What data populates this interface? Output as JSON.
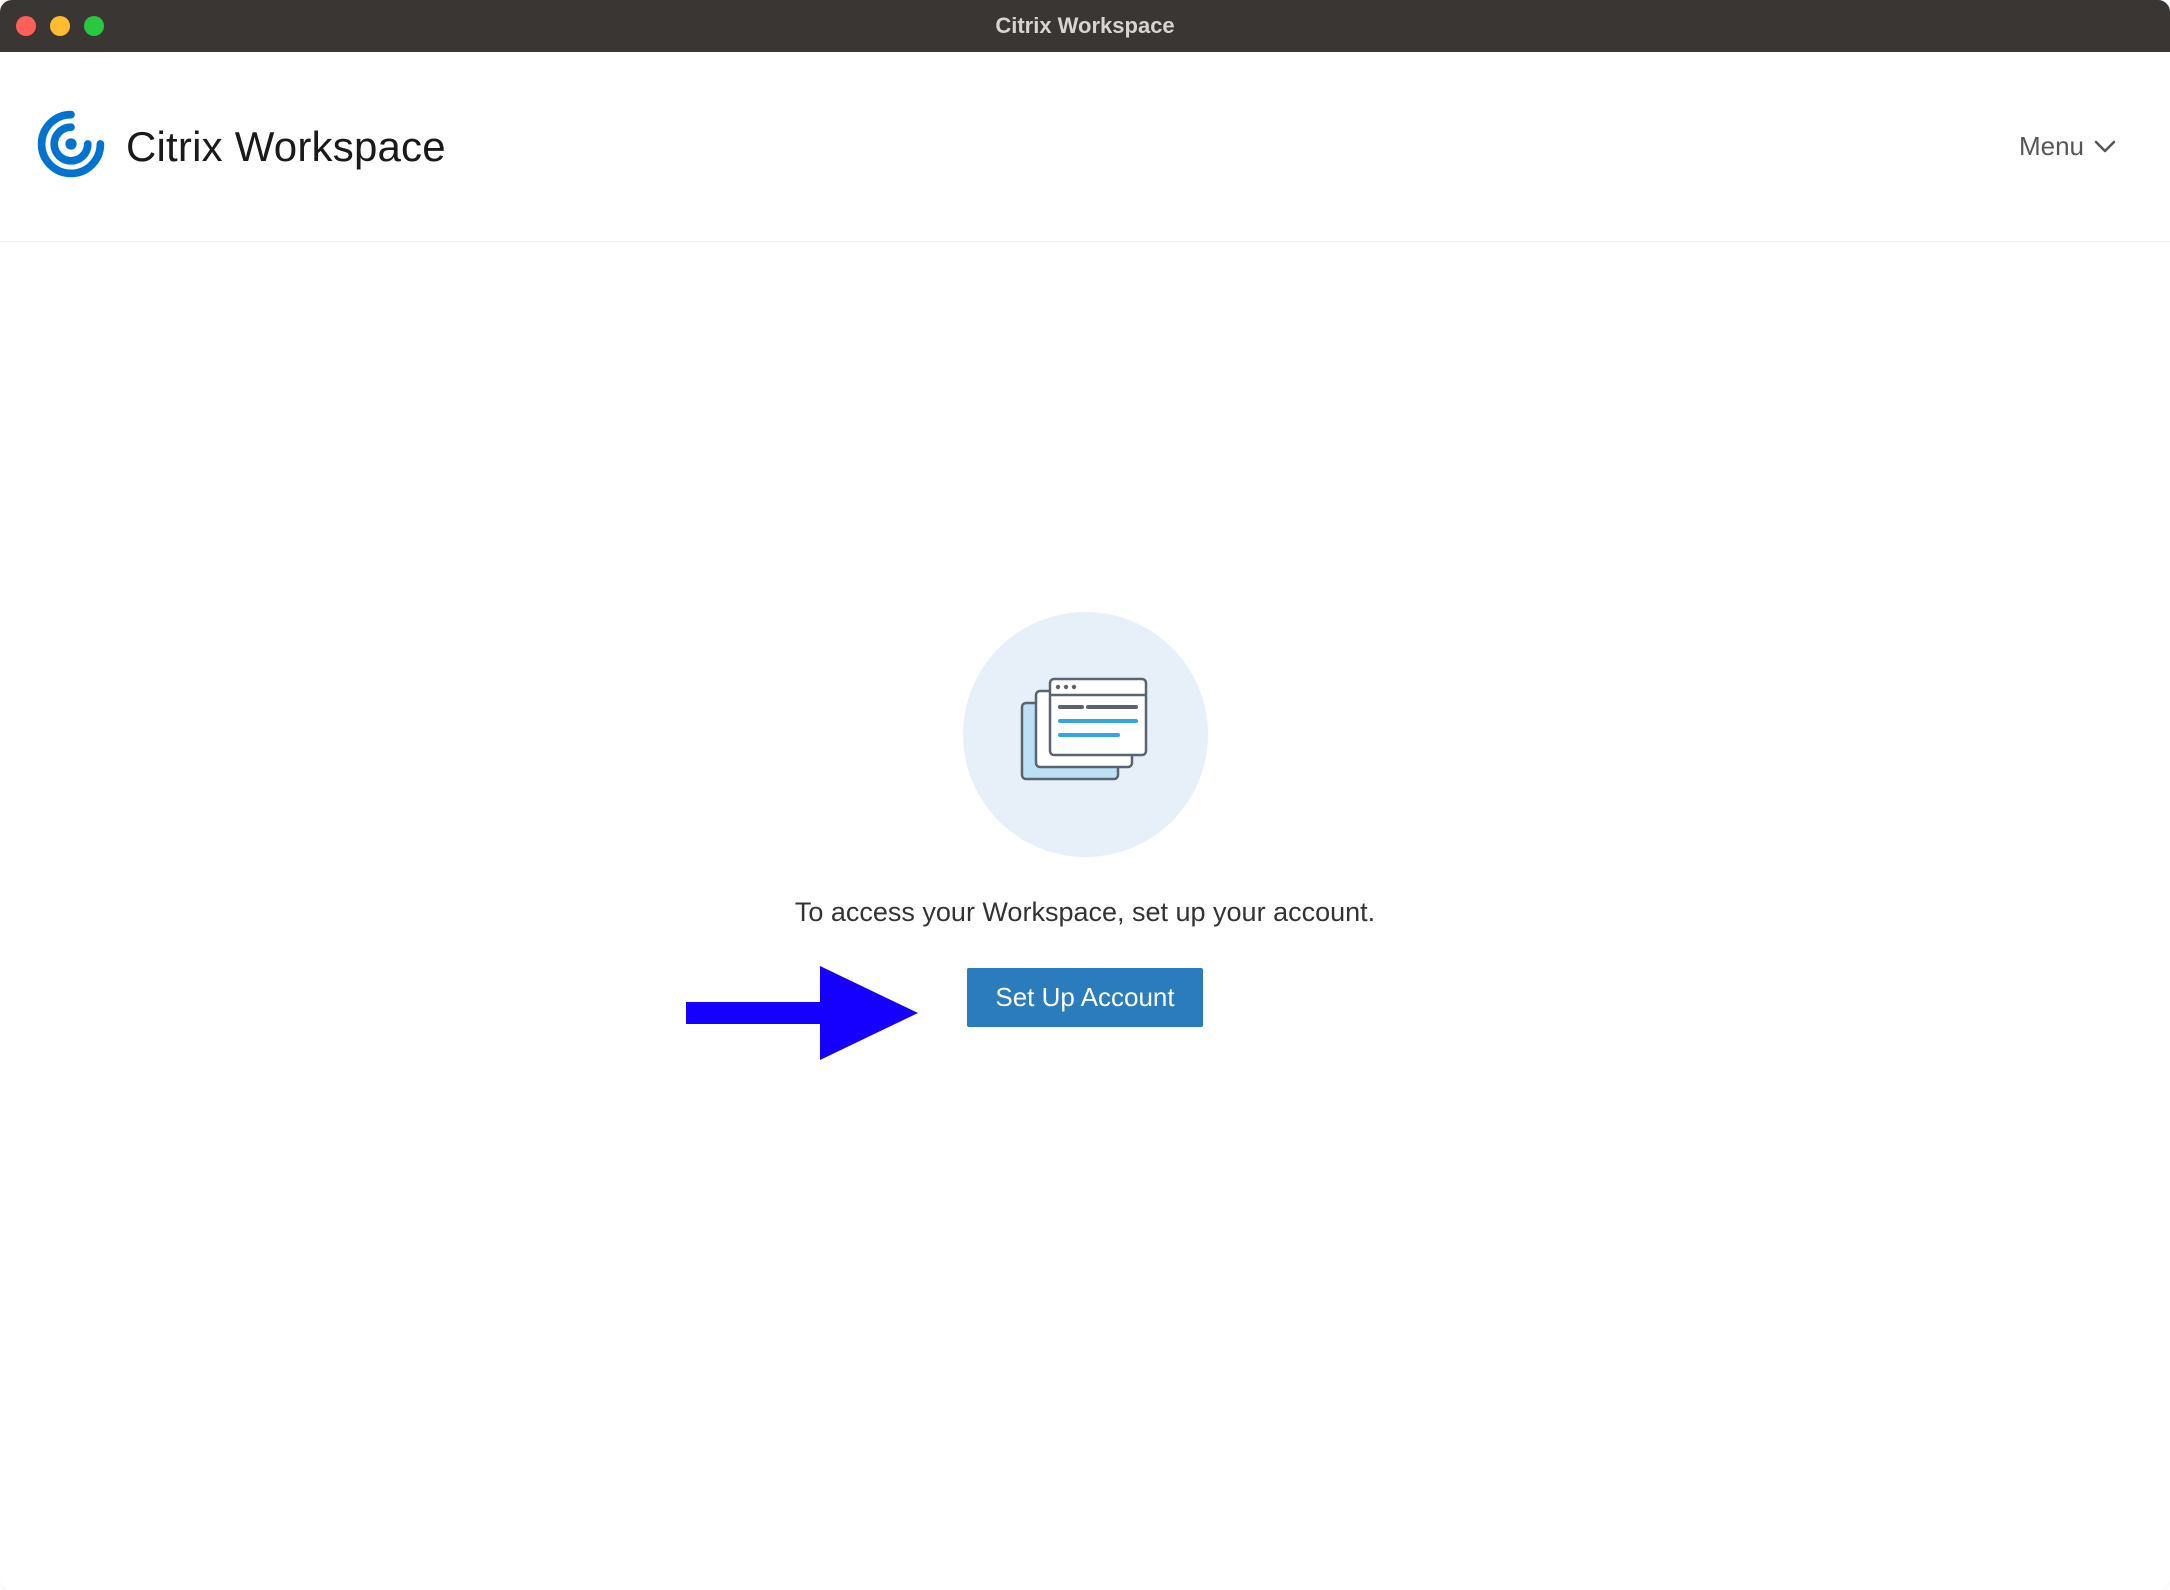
{
  "window": {
    "title": "Citrix Workspace"
  },
  "header": {
    "brand_name": "Citrix Workspace",
    "menu_label": "Menu"
  },
  "main": {
    "instruction": "To access your Workspace, set up your account.",
    "setup_button_label": "Set Up Account"
  },
  "colors": {
    "brand_blue": "#0073d1",
    "button_blue": "#2b7cbd",
    "annotation_blue": "#1500ff",
    "illustration_bg": "#e7f0f9"
  }
}
